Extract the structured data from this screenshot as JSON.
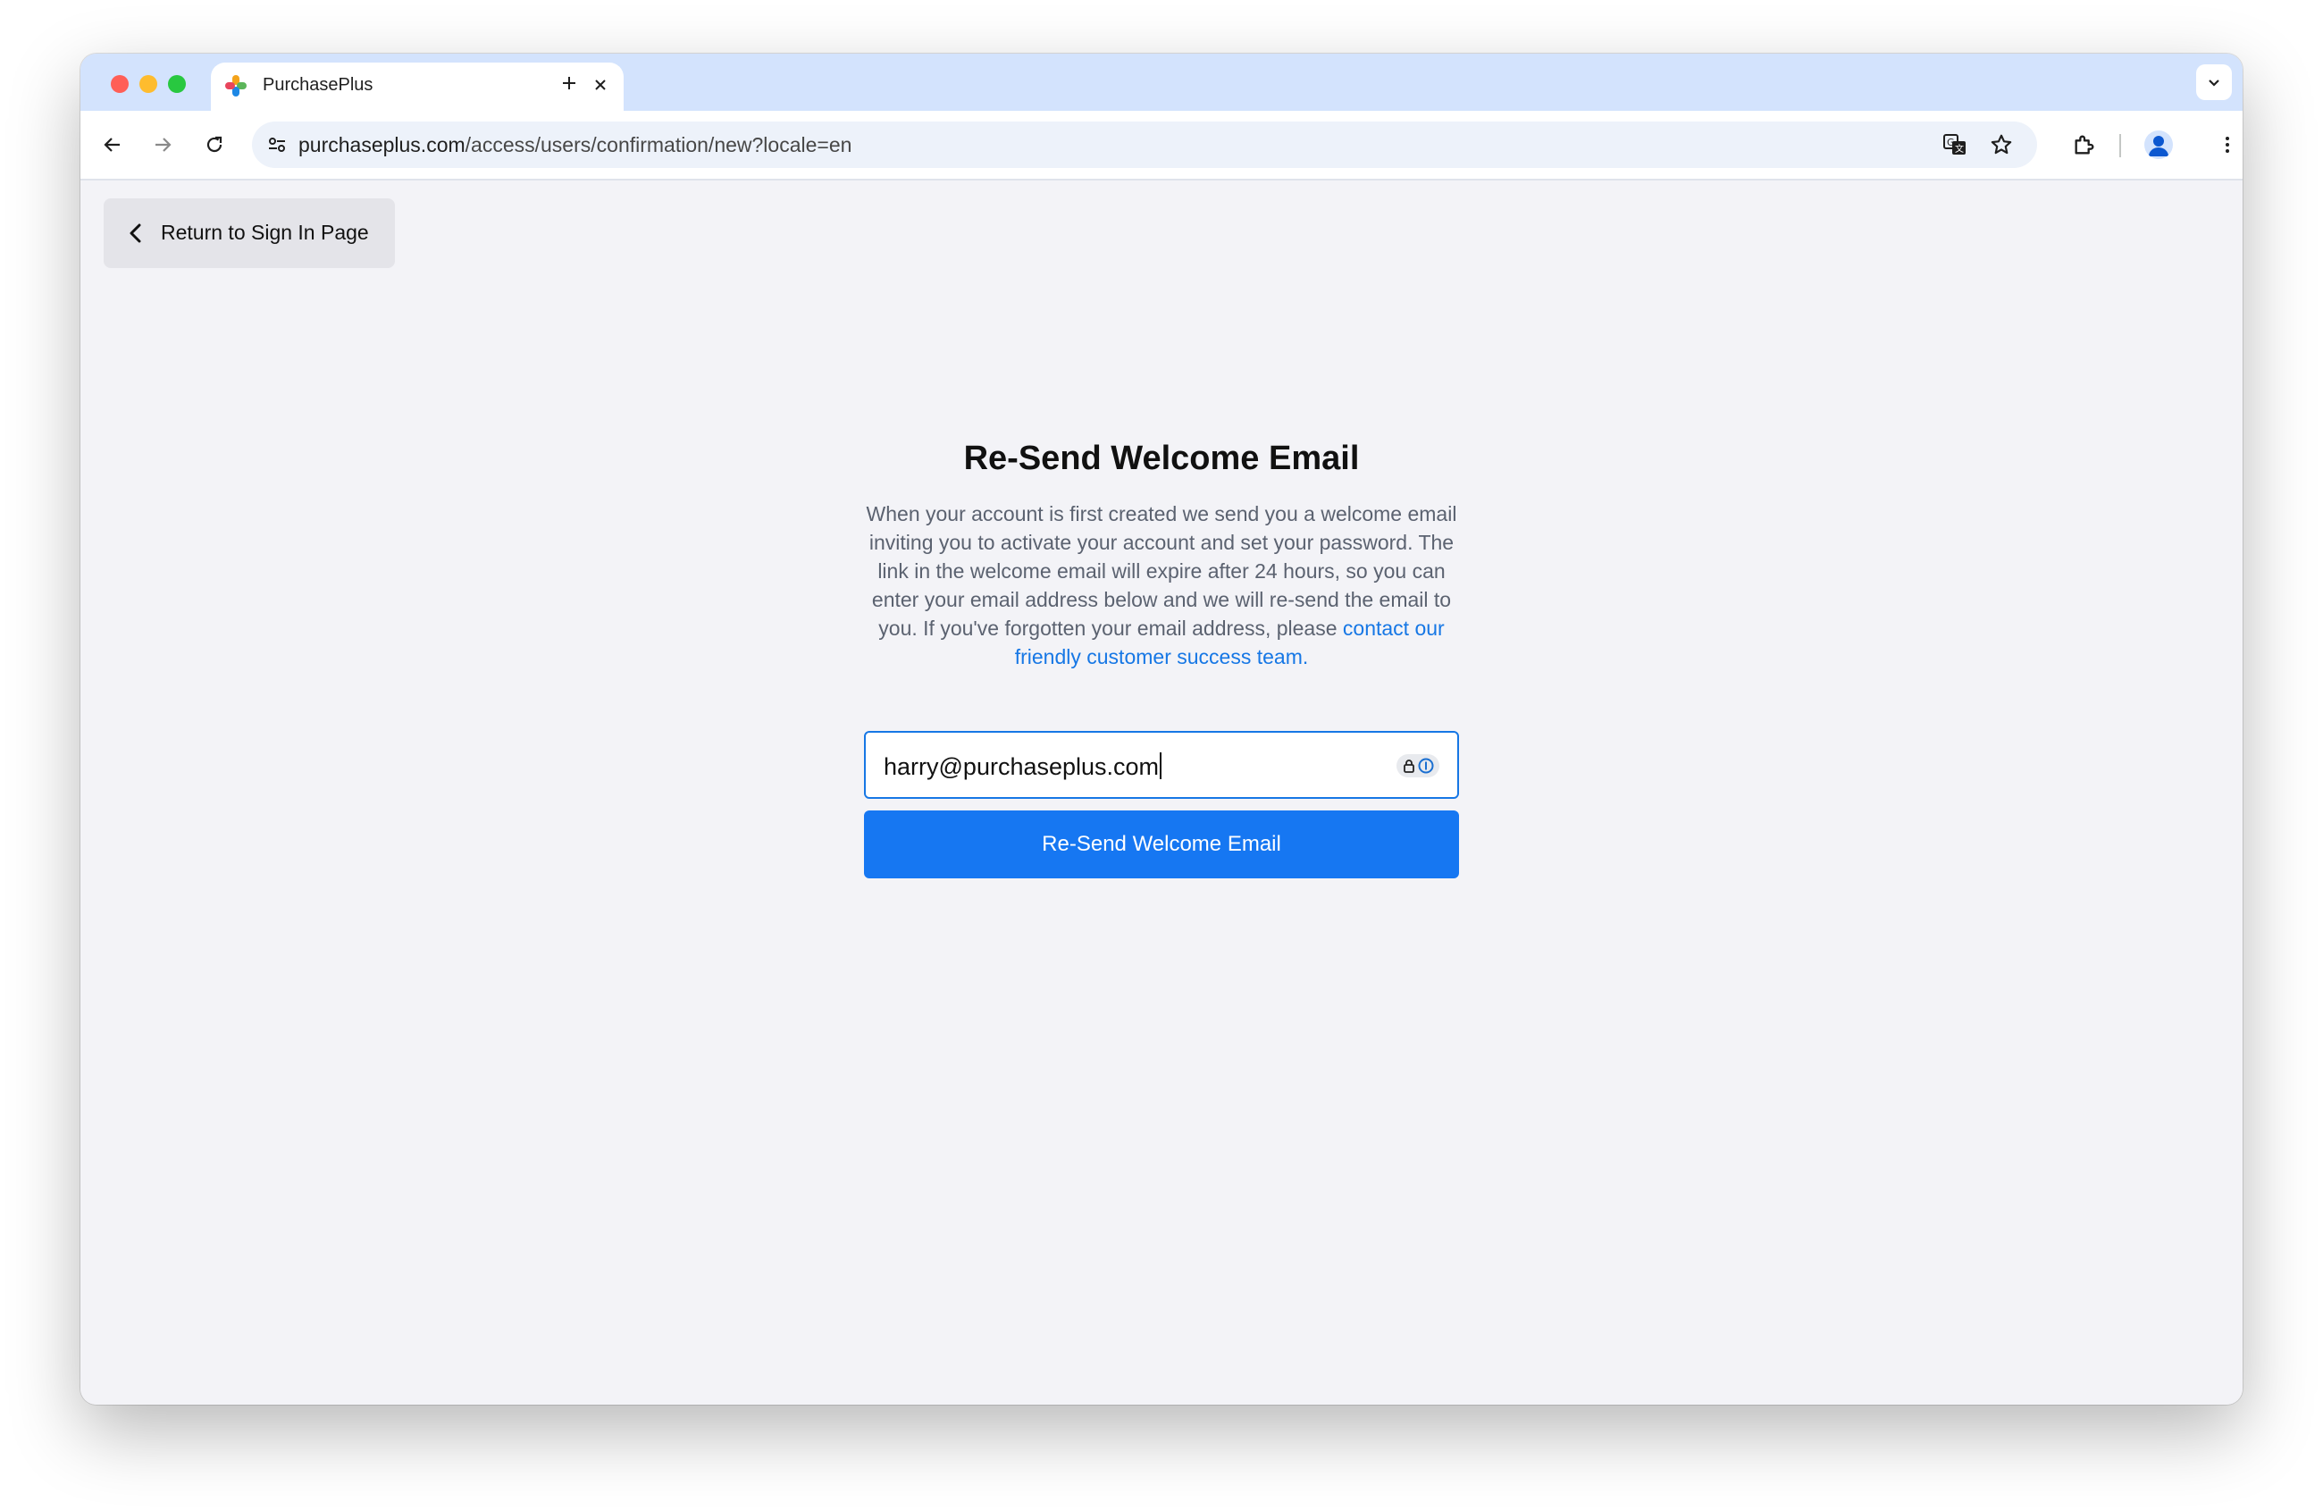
{
  "browser": {
    "tab": {
      "title": "PurchasePlus",
      "favicon": "purchaseplus-logo-icon"
    },
    "url": {
      "domain": "purchaseplus.com",
      "path": "/access/users/confirmation/new?locale=en"
    }
  },
  "page": {
    "back_link_label": "Return to Sign In Page",
    "title": "Re-Send Welcome Email",
    "description": "When your account is first created we send you a welcome email inviting you to activate your account and set your password. The link in the welcome email will expire after 24 hours, so you can enter your email address below and we will re-send the email to you. If you've forgotten your email address, please ",
    "description_link": "contact our friendly customer success team.",
    "email_value": "harry@purchaseplus.com",
    "submit_label": "Re-Send Welcome Email"
  },
  "colors": {
    "accent": "#1677f2",
    "link": "#1677e5",
    "tabstrip": "#d3e3fd",
    "page_background": "#f3f3f7"
  }
}
